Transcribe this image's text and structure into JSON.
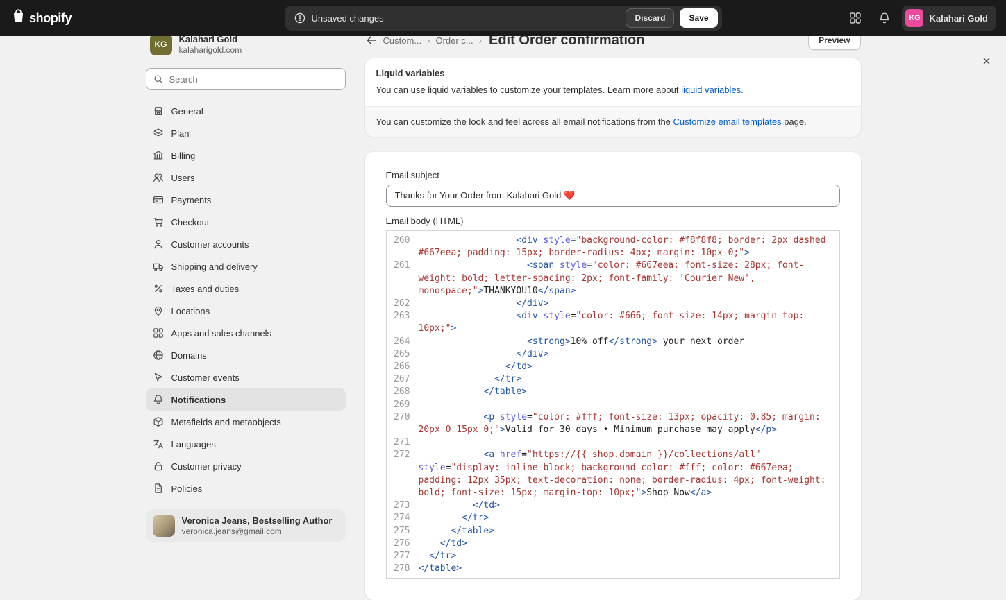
{
  "topbar": {
    "logo": "shopify",
    "unsaved": "Unsaved changes",
    "discard": "Discard",
    "save": "Save",
    "user_initials": "KG",
    "user_name": "Kalahari Gold",
    "user_avatar_color": "#eb4b9d"
  },
  "sidebar": {
    "store_initials": "KG",
    "store_name": "Kalahari Gold",
    "store_domain": "kalaharigold.com",
    "store_avatar_color": "#6f6d2f",
    "search_placeholder": "Search",
    "items": [
      {
        "label": "General",
        "icon": "store-icon"
      },
      {
        "label": "Plan",
        "icon": "plan-icon"
      },
      {
        "label": "Billing",
        "icon": "billing-icon"
      },
      {
        "label": "Users",
        "icon": "users-icon"
      },
      {
        "label": "Payments",
        "icon": "payments-icon"
      },
      {
        "label": "Checkout",
        "icon": "checkout-icon"
      },
      {
        "label": "Customer accounts",
        "icon": "customer-accounts-icon"
      },
      {
        "label": "Shipping and delivery",
        "icon": "shipping-icon"
      },
      {
        "label": "Taxes and duties",
        "icon": "taxes-icon"
      },
      {
        "label": "Locations",
        "icon": "locations-icon"
      },
      {
        "label": "Apps and sales channels",
        "icon": "apps-grid-icon"
      },
      {
        "label": "Domains",
        "icon": "globe-icon"
      },
      {
        "label": "Customer events",
        "icon": "cursor-icon"
      },
      {
        "label": "Notifications",
        "icon": "bell-icon",
        "selected": true
      },
      {
        "label": "Metafields and metaobjects",
        "icon": "box-icon"
      },
      {
        "label": "Languages",
        "icon": "translate-icon"
      },
      {
        "label": "Customer privacy",
        "icon": "lock-icon"
      },
      {
        "label": "Policies",
        "icon": "document-icon"
      }
    ],
    "footer_user": {
      "name": "Veronica Jeans, Bestselling Author",
      "email": "veronica.jeans@gmail.com"
    }
  },
  "header": {
    "crumb1": "Custom...",
    "crumb2": "Order c...",
    "separator": "›",
    "title": "Edit Order confirmation",
    "preview": "Preview"
  },
  "liquid_card": {
    "title": "Liquid variables",
    "body_text": "You can use liquid variables to customize your templates. Learn more about ",
    "body_link": "liquid variables.",
    "footer_text": "You can customize the look and feel across all email notifications from the ",
    "footer_link": "Customize email templates",
    "footer_suffix": " page.",
    "link_color": "#005bd3"
  },
  "email_card": {
    "subject_label": "Email subject",
    "subject_value": "Thanks for Your Order from Kalahari Gold ❤️",
    "body_label": "Email body (HTML)"
  },
  "code_editor": {
    "colors": {
      "plain": "#202223",
      "tag": "#2054a6",
      "attr": "#5b5be6",
      "string": "#a8352f",
      "line_number": "#999999"
    },
    "lines": [
      {
        "n": 260,
        "tk": [
          [
            "p",
            "                  "
          ],
          [
            "t",
            "<div"
          ],
          [
            "p",
            " "
          ],
          [
            "a",
            "style"
          ],
          [
            "p",
            "="
          ],
          [
            "s",
            "\"background-color: #f8f8f8; border: 2px dashed #667eea; padding: 15px; border-radius: 4px; margin: 10px 0;\""
          ],
          [
            "t",
            ">"
          ]
        ]
      },
      {
        "n": 261,
        "tk": [
          [
            "p",
            "                    "
          ],
          [
            "t",
            "<span"
          ],
          [
            "p",
            " "
          ],
          [
            "a",
            "style"
          ],
          [
            "p",
            "="
          ],
          [
            "s",
            "\"color: #667eea; font-size: 28px; font-weight: bold; letter-spacing: 2px; font-family: 'Courier New', monospace;\""
          ],
          [
            "t",
            ">"
          ],
          [
            "p",
            "THANKYOU10"
          ],
          [
            "t",
            "</span>"
          ]
        ]
      },
      {
        "n": 262,
        "tk": [
          [
            "p",
            "                  "
          ],
          [
            "t",
            "</div>"
          ]
        ]
      },
      {
        "n": 263,
        "tk": [
          [
            "p",
            "                  "
          ],
          [
            "t",
            "<div"
          ],
          [
            "p",
            " "
          ],
          [
            "a",
            "style"
          ],
          [
            "p",
            "="
          ],
          [
            "s",
            "\"color: #666; font-size: 14px; margin-top: 10px;\""
          ],
          [
            "t",
            ">"
          ]
        ]
      },
      {
        "n": 264,
        "tk": [
          [
            "p",
            "                    "
          ],
          [
            "t",
            "<strong>"
          ],
          [
            "p",
            "10% off"
          ],
          [
            "t",
            "</strong>"
          ],
          [
            "p",
            " your next order"
          ]
        ]
      },
      {
        "n": 265,
        "tk": [
          [
            "p",
            "                  "
          ],
          [
            "t",
            "</div>"
          ]
        ]
      },
      {
        "n": 266,
        "tk": [
          [
            "p",
            "                "
          ],
          [
            "t",
            "</td>"
          ]
        ]
      },
      {
        "n": 267,
        "tk": [
          [
            "p",
            "              "
          ],
          [
            "t",
            "</tr>"
          ]
        ]
      },
      {
        "n": 268,
        "tk": [
          [
            "p",
            "            "
          ],
          [
            "t",
            "</table>"
          ]
        ]
      },
      {
        "n": 269,
        "tk": []
      },
      {
        "n": 270,
        "tk": [
          [
            "p",
            "            "
          ],
          [
            "t",
            "<p"
          ],
          [
            "p",
            " "
          ],
          [
            "a",
            "style"
          ],
          [
            "p",
            "="
          ],
          [
            "s",
            "\"color: #fff; font-size: 13px; opacity: 0.85; margin: 20px 0 15px 0;\""
          ],
          [
            "t",
            ">"
          ],
          [
            "p",
            "Valid for 30 days • Minimum purchase may apply"
          ],
          [
            "t",
            "</p>"
          ]
        ]
      },
      {
        "n": 271,
        "tk": []
      },
      {
        "n": 272,
        "tk": [
          [
            "p",
            "            "
          ],
          [
            "t",
            "<a"
          ],
          [
            "p",
            " "
          ],
          [
            "a",
            "href"
          ],
          [
            "p",
            "="
          ],
          [
            "s",
            "\"https://{{ shop.domain }}/collections/all\""
          ],
          [
            "p",
            " "
          ],
          [
            "a",
            "style"
          ],
          [
            "p",
            "="
          ],
          [
            "s",
            "\"display: inline-block; background-color: #fff; color: #667eea; padding: 12px 35px; text-decoration: none; border-radius: 4px; font-weight: bold; font-size: 15px; margin-top: 10px;\""
          ],
          [
            "t",
            ">"
          ],
          [
            "p",
            "Shop Now"
          ],
          [
            "t",
            "</a>"
          ]
        ]
      },
      {
        "n": 273,
        "tk": [
          [
            "p",
            "          "
          ],
          [
            "t",
            "</td>"
          ]
        ]
      },
      {
        "n": 274,
        "tk": [
          [
            "p",
            "        "
          ],
          [
            "t",
            "</tr>"
          ]
        ]
      },
      {
        "n": 275,
        "tk": [
          [
            "p",
            "      "
          ],
          [
            "t",
            "</table>"
          ]
        ]
      },
      {
        "n": 276,
        "tk": [
          [
            "p",
            "    "
          ],
          [
            "t",
            "</td>"
          ]
        ]
      },
      {
        "n": 277,
        "tk": [
          [
            "p",
            "  "
          ],
          [
            "t",
            "</tr>"
          ]
        ]
      },
      {
        "n": 278,
        "tk": [
          [
            "t",
            "</table>"
          ]
        ]
      }
    ]
  }
}
